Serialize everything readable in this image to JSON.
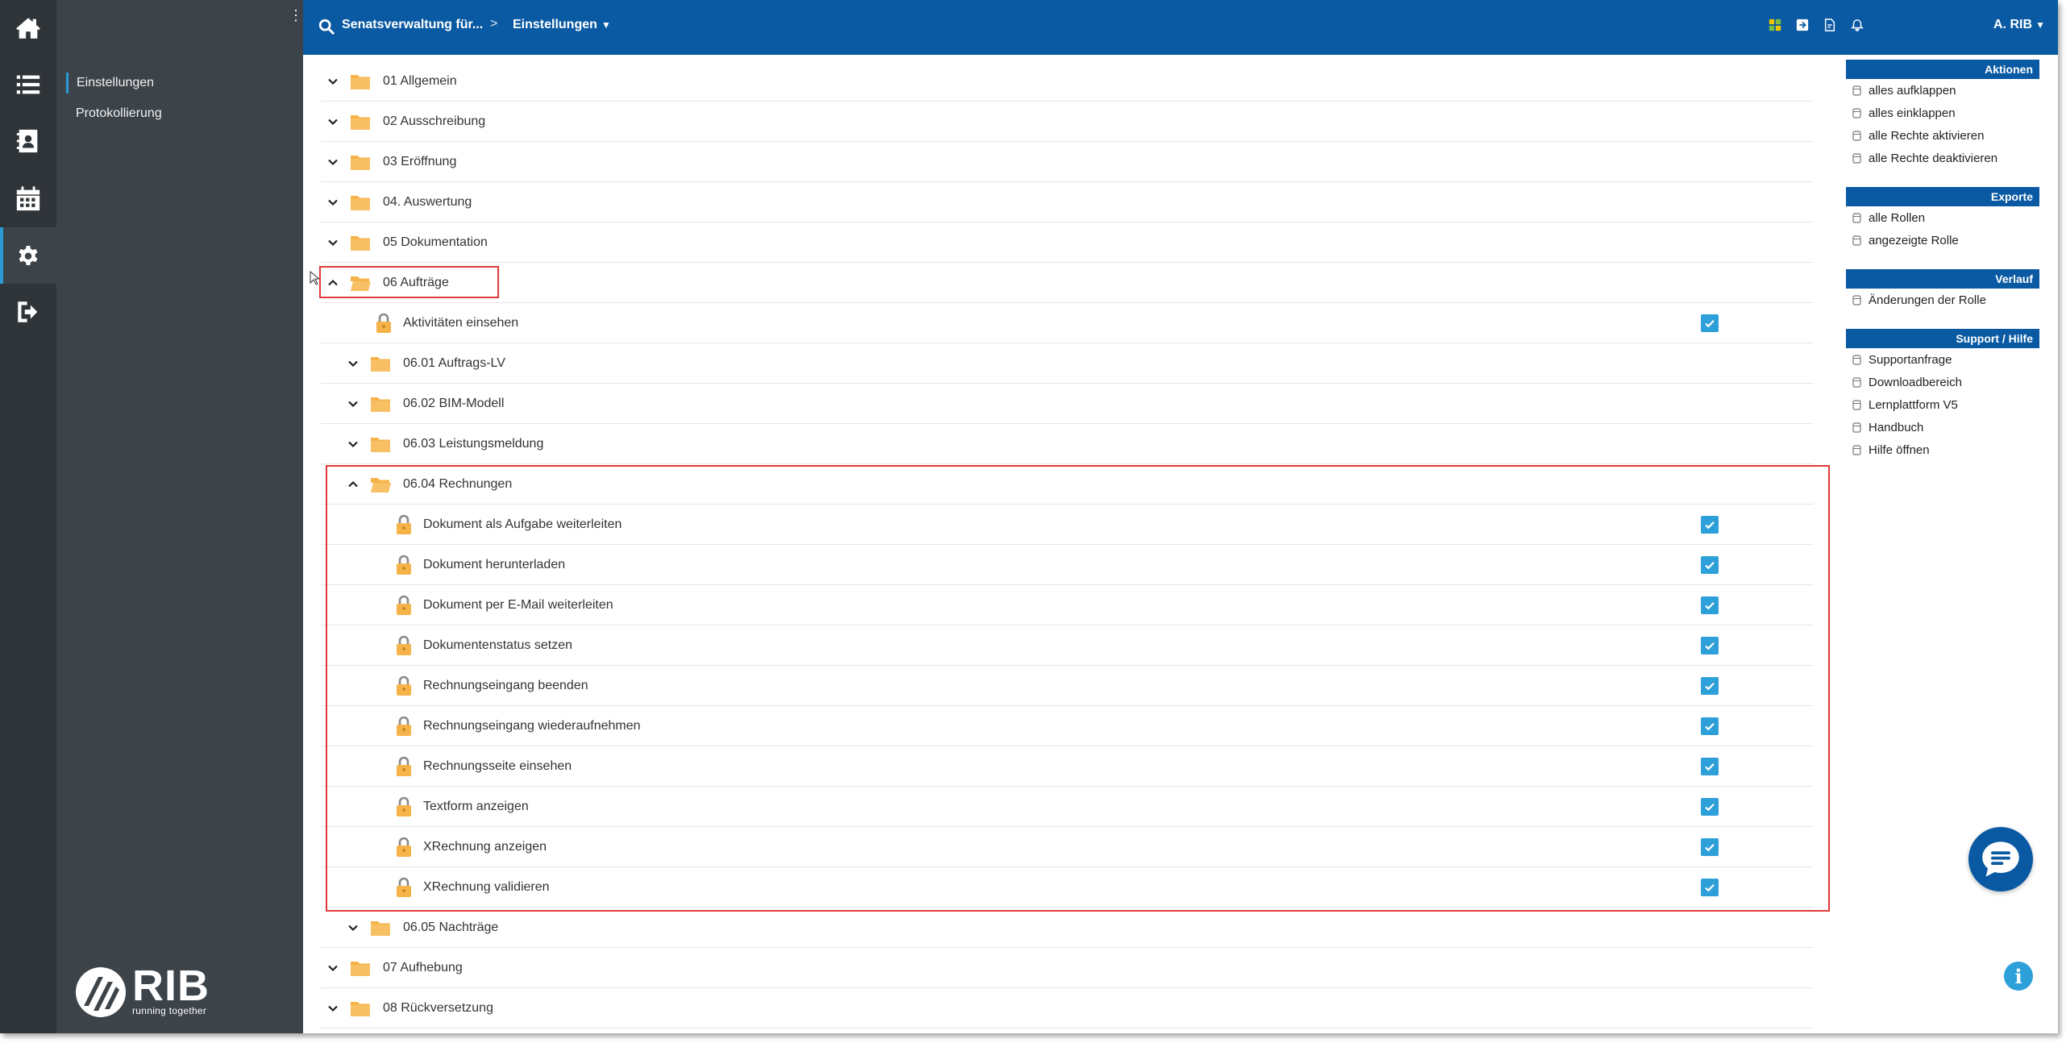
{
  "header": {
    "crumb_client": "Senatsverwaltung für...",
    "crumb_separator": ">",
    "crumb_page": "Einstellungen",
    "user_name": "A. RIB"
  },
  "subnav": {
    "items": [
      {
        "label": "Einstellungen",
        "active": true
      },
      {
        "label": "Protokollierung",
        "active": false
      }
    ],
    "logo_word": "RIB",
    "logo_tagline": "running together"
  },
  "tree": {
    "rows": [
      {
        "type": "folder",
        "label": "01 Allgemein",
        "expanded": false
      },
      {
        "type": "folder",
        "label": "02 Ausschreibung",
        "expanded": false
      },
      {
        "type": "folder",
        "label": "03 Eröffnung",
        "expanded": false
      },
      {
        "type": "folder",
        "label": "04. Auswertung",
        "expanded": false
      },
      {
        "type": "folder",
        "label": "05 Dokumentation",
        "expanded": false
      },
      {
        "type": "folder",
        "label": "06 Aufträge",
        "expanded": true
      },
      {
        "type": "right",
        "label": "Aktivitäten einsehen",
        "checked": true
      },
      {
        "type": "folder",
        "label": "06.01 Auftrags-LV",
        "expanded": false
      },
      {
        "type": "folder",
        "label": "06.02 BIM-Modell",
        "expanded": false
      },
      {
        "type": "folder",
        "label": "06.03 Leistungsmeldung",
        "expanded": false
      },
      {
        "type": "folder",
        "label": "06.04 Rechnungen",
        "expanded": true
      },
      {
        "type": "right",
        "label": "Dokument als Aufgabe weiterleiten",
        "checked": true
      },
      {
        "type": "right",
        "label": "Dokument herunterladen",
        "checked": true
      },
      {
        "type": "right",
        "label": "Dokument per E-Mail weiterleiten",
        "checked": true
      },
      {
        "type": "right",
        "label": "Dokumentenstatus setzen",
        "checked": true
      },
      {
        "type": "right",
        "label": "Rechnungseingang beenden",
        "checked": true
      },
      {
        "type": "right",
        "label": "Rechnungseingang wiederaufnehmen",
        "checked": true
      },
      {
        "type": "right",
        "label": "Rechnungsseite einsehen",
        "checked": true
      },
      {
        "type": "right",
        "label": "Textform anzeigen",
        "checked": true
      },
      {
        "type": "right",
        "label": "XRechnung anzeigen",
        "checked": true
      },
      {
        "type": "right",
        "label": "XRechnung validieren",
        "checked": true
      },
      {
        "type": "folder",
        "label": "06.05 Nachträge",
        "expanded": false
      },
      {
        "type": "folder",
        "label": "07 Aufhebung",
        "expanded": false
      },
      {
        "type": "folder",
        "label": "08 Rückversetzung",
        "expanded": false
      }
    ]
  },
  "right_panel": {
    "sections": [
      {
        "title": "Aktionen",
        "items": [
          "alles aufklappen",
          "alles einklappen",
          "alle Rechte aktivieren",
          "alle Rechte deaktivieren"
        ]
      },
      {
        "title": "Exporte",
        "items": [
          "alle Rollen",
          "angezeigte Rolle"
        ]
      },
      {
        "title": "Verlauf",
        "items": [
          "Änderungen der Rolle"
        ]
      },
      {
        "title": "Support / Hilfe",
        "items": [
          "Supportanfrage",
          "Downloadbereich",
          "Lernplattform V5",
          "Handbuch",
          "Hilfe öffnen"
        ]
      }
    ]
  },
  "colors": {
    "brand_blue": "#0a5aa3",
    "checkbox_blue": "#2d9fd9",
    "folder_orange": "#f6b349",
    "highlight_red": "#e03a3a",
    "sidebar_dark": "#2f3438"
  }
}
